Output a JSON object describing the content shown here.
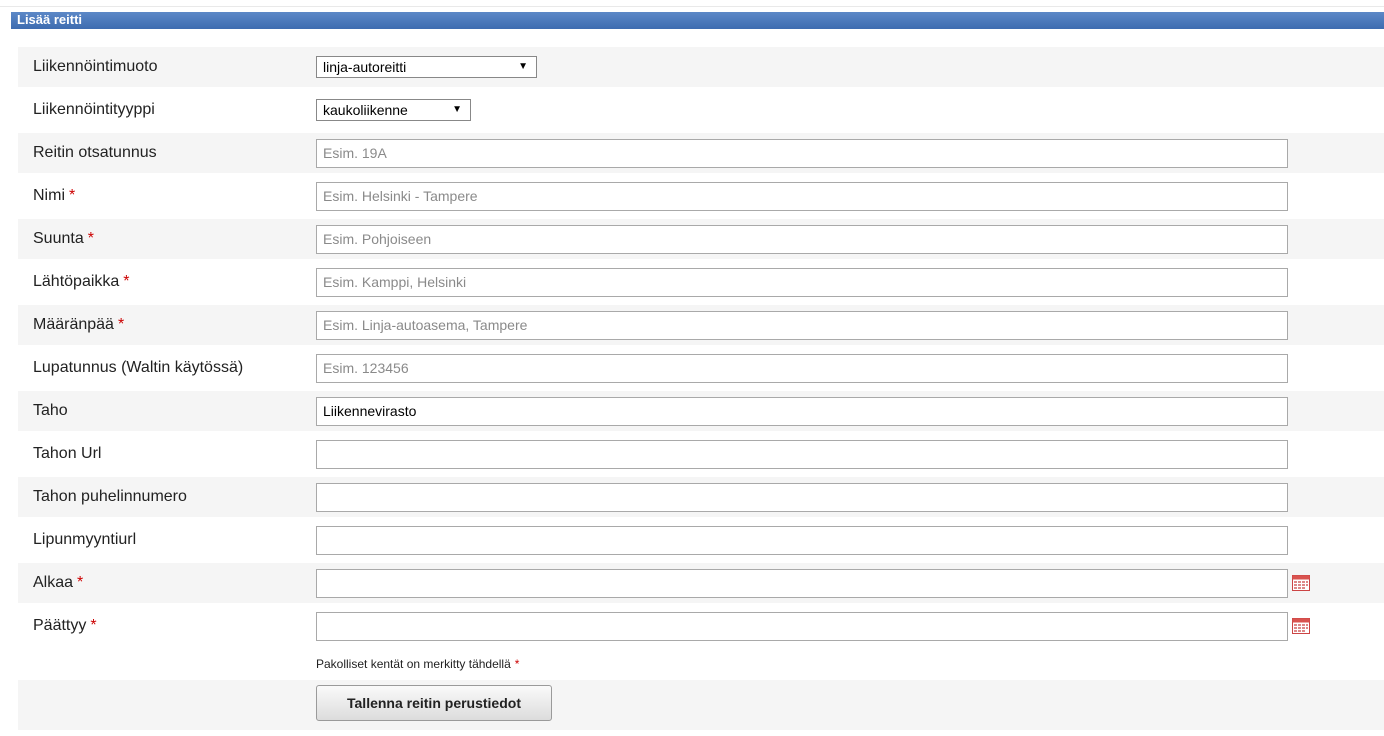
{
  "title": "Lisää reitti",
  "fields": {
    "liikennointimuoto": {
      "label": "Liikennöintimuoto",
      "value": "linja-autoreitti"
    },
    "liikennointityyppi": {
      "label": "Liikennöintityyppi",
      "value": "kaukoliikenne"
    },
    "otsatunnus": {
      "label": "Reitin otsatunnus",
      "placeholder": "Esim. 19A",
      "value": ""
    },
    "nimi": {
      "label": "Nimi",
      "placeholder": "Esim. Helsinki - Tampere",
      "value": ""
    },
    "suunta": {
      "label": "Suunta",
      "placeholder": "Esim. Pohjoiseen",
      "value": ""
    },
    "lahtopaikka": {
      "label": "Lähtöpaikka",
      "placeholder": "Esim. Kamppi, Helsinki",
      "value": ""
    },
    "maaranpaa": {
      "label": "Määränpää",
      "placeholder": "Esim. Linja-autoasema, Tampere",
      "value": ""
    },
    "lupatunnus": {
      "label": "Lupatunnus (Waltin käytössä)",
      "placeholder": "Esim. 123456",
      "value": ""
    },
    "taho": {
      "label": "Taho",
      "value": "Liikennevirasto"
    },
    "tahon_url": {
      "label": "Tahon Url",
      "value": ""
    },
    "tahon_puhelin": {
      "label": "Tahon puhelinnumero",
      "value": ""
    },
    "lipunmyyntiurl": {
      "label": "Lipunmyyntiurl",
      "value": ""
    },
    "alkaa": {
      "label": "Alkaa",
      "value": ""
    },
    "paattyy": {
      "label": "Päättyy",
      "value": ""
    }
  },
  "required_marker": "*",
  "note": "Pakolliset kentät on merkitty tähdellä",
  "save_label": "Tallenna reitin perustiedot",
  "icons": {
    "calendar": "calendar-icon",
    "dropdown": "chevron-down-icon"
  },
  "colors": {
    "titlebar": "#4a78bb",
    "required": "#cc0000"
  }
}
